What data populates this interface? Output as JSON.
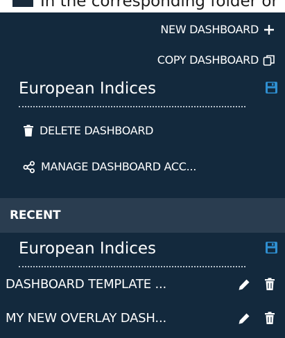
{
  "background_text": "In the corresponding folder or",
  "actions": {
    "new_dashboard": "NEW DASHBOARD",
    "copy_dashboard": "COPY DASHBOARD",
    "delete_dashboard": "DELETE DASHBOARD",
    "manage_access": "MANAGE DASHBOARD ACC..."
  },
  "current_dashboard": {
    "name": "European Indices"
  },
  "recent": {
    "header": "RECENT",
    "current_name": "European Indices",
    "items": [
      {
        "label": "DASHBOARD TEMPLATE ..."
      },
      {
        "label": "MY NEW OVERLAY DASH..."
      }
    ]
  },
  "colors": {
    "panel_bg": "#13293d",
    "recent_header_bg": "#2a3d50",
    "accent_blue": "#2f8fd1",
    "text": "#ffffff"
  },
  "icons": {
    "new": "plus-icon",
    "copy": "copy-icon",
    "save": "save-icon",
    "delete": "trash-icon",
    "share": "share-icon",
    "edit": "pencil-icon"
  }
}
